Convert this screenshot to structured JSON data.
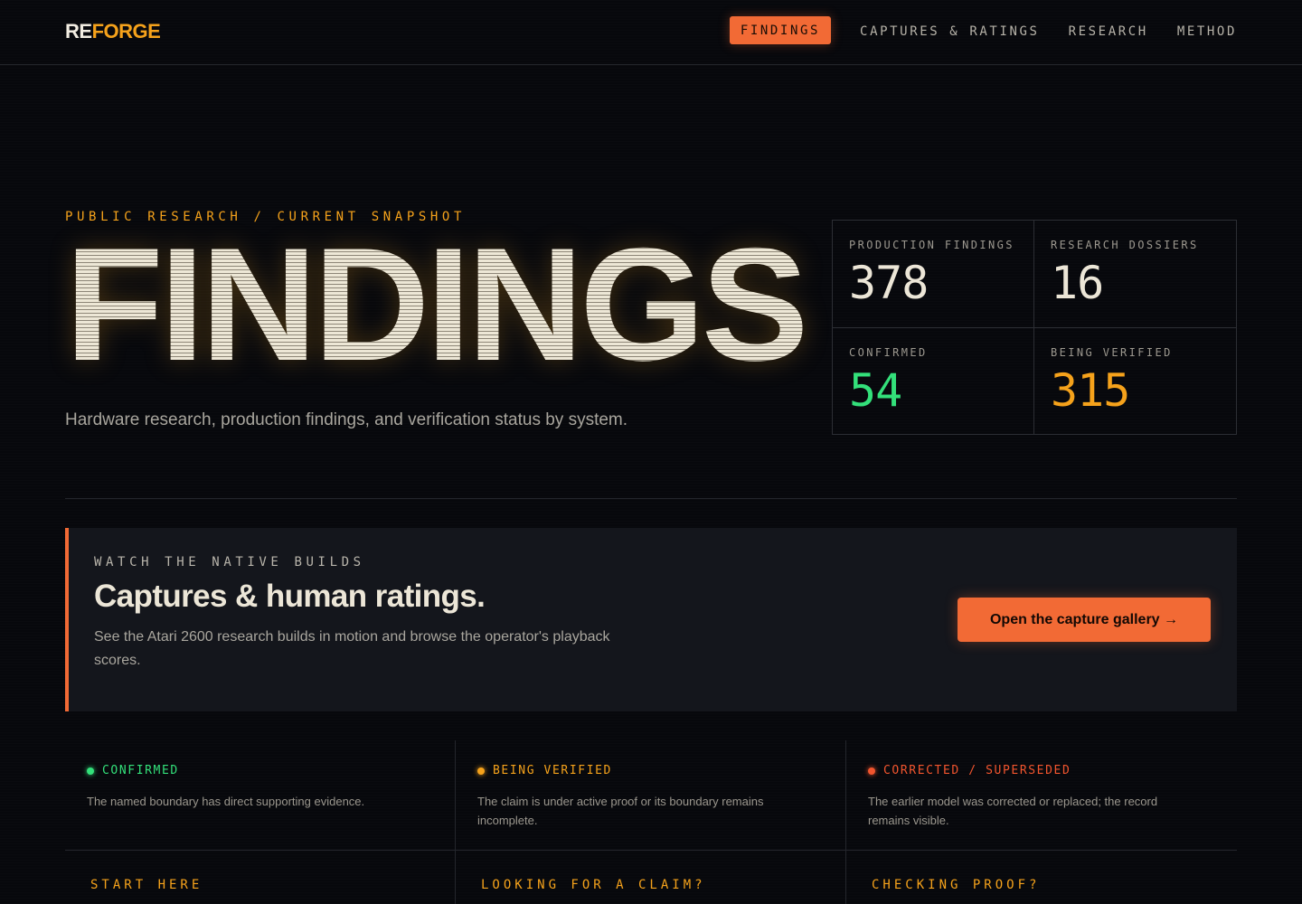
{
  "header": {
    "logo_re": "RE",
    "logo_forge": "FORGE",
    "nav": [
      {
        "label": "FINDINGS",
        "active": true
      },
      {
        "label": "CAPTURES & RATINGS",
        "active": false
      },
      {
        "label": "RESEARCH",
        "active": false
      },
      {
        "label": "METHOD",
        "active": false
      }
    ]
  },
  "hero": {
    "eyebrow": "PUBLIC RESEARCH / CURRENT SNAPSHOT",
    "title": "FINDINGS",
    "subtitle": "Hardware research, production findings, and verification status by system."
  },
  "stats": [
    {
      "label": "PRODUCTION FINDINGS",
      "value": "378",
      "color": "#ece6d7"
    },
    {
      "label": "RESEARCH DOSSIERS",
      "value": "16",
      "color": "#ece6d7"
    },
    {
      "label": "CONFIRMED",
      "value": "54",
      "color": "#33e07a"
    },
    {
      "label": "BEING VERIFIED",
      "value": "315",
      "color": "#f5a21b"
    }
  ],
  "capture_card": {
    "eyebrow": "WATCH THE NATIVE BUILDS",
    "title": "Captures & human ratings.",
    "description": "See the Atari 2600 research builds in motion and browse the operator's playback scores.",
    "button_label": "Open the capture gallery →"
  },
  "statuses": [
    {
      "label": "CONFIRMED",
      "color": "#33e07a",
      "description": "The named boundary has direct supporting evidence."
    },
    {
      "label": "BEING VERIFIED",
      "color": "#f5a21b",
      "description": "The claim is under active proof or its boundary remains incomplete."
    },
    {
      "label": "CORRECTED / SUPERSEDED",
      "color": "#f2552e",
      "description": "The earlier model was corrected or replaced; the record remains visible."
    }
  ],
  "bottom_eyebrows": [
    "START HERE",
    "LOOKING FOR A CLAIM?",
    "CHECKING PROOF?"
  ],
  "colors": {
    "accent_orange": "#f26a35",
    "accent_amber": "#f5a21b",
    "confirmed_green": "#33e07a",
    "superseded_red": "#f2552e"
  }
}
